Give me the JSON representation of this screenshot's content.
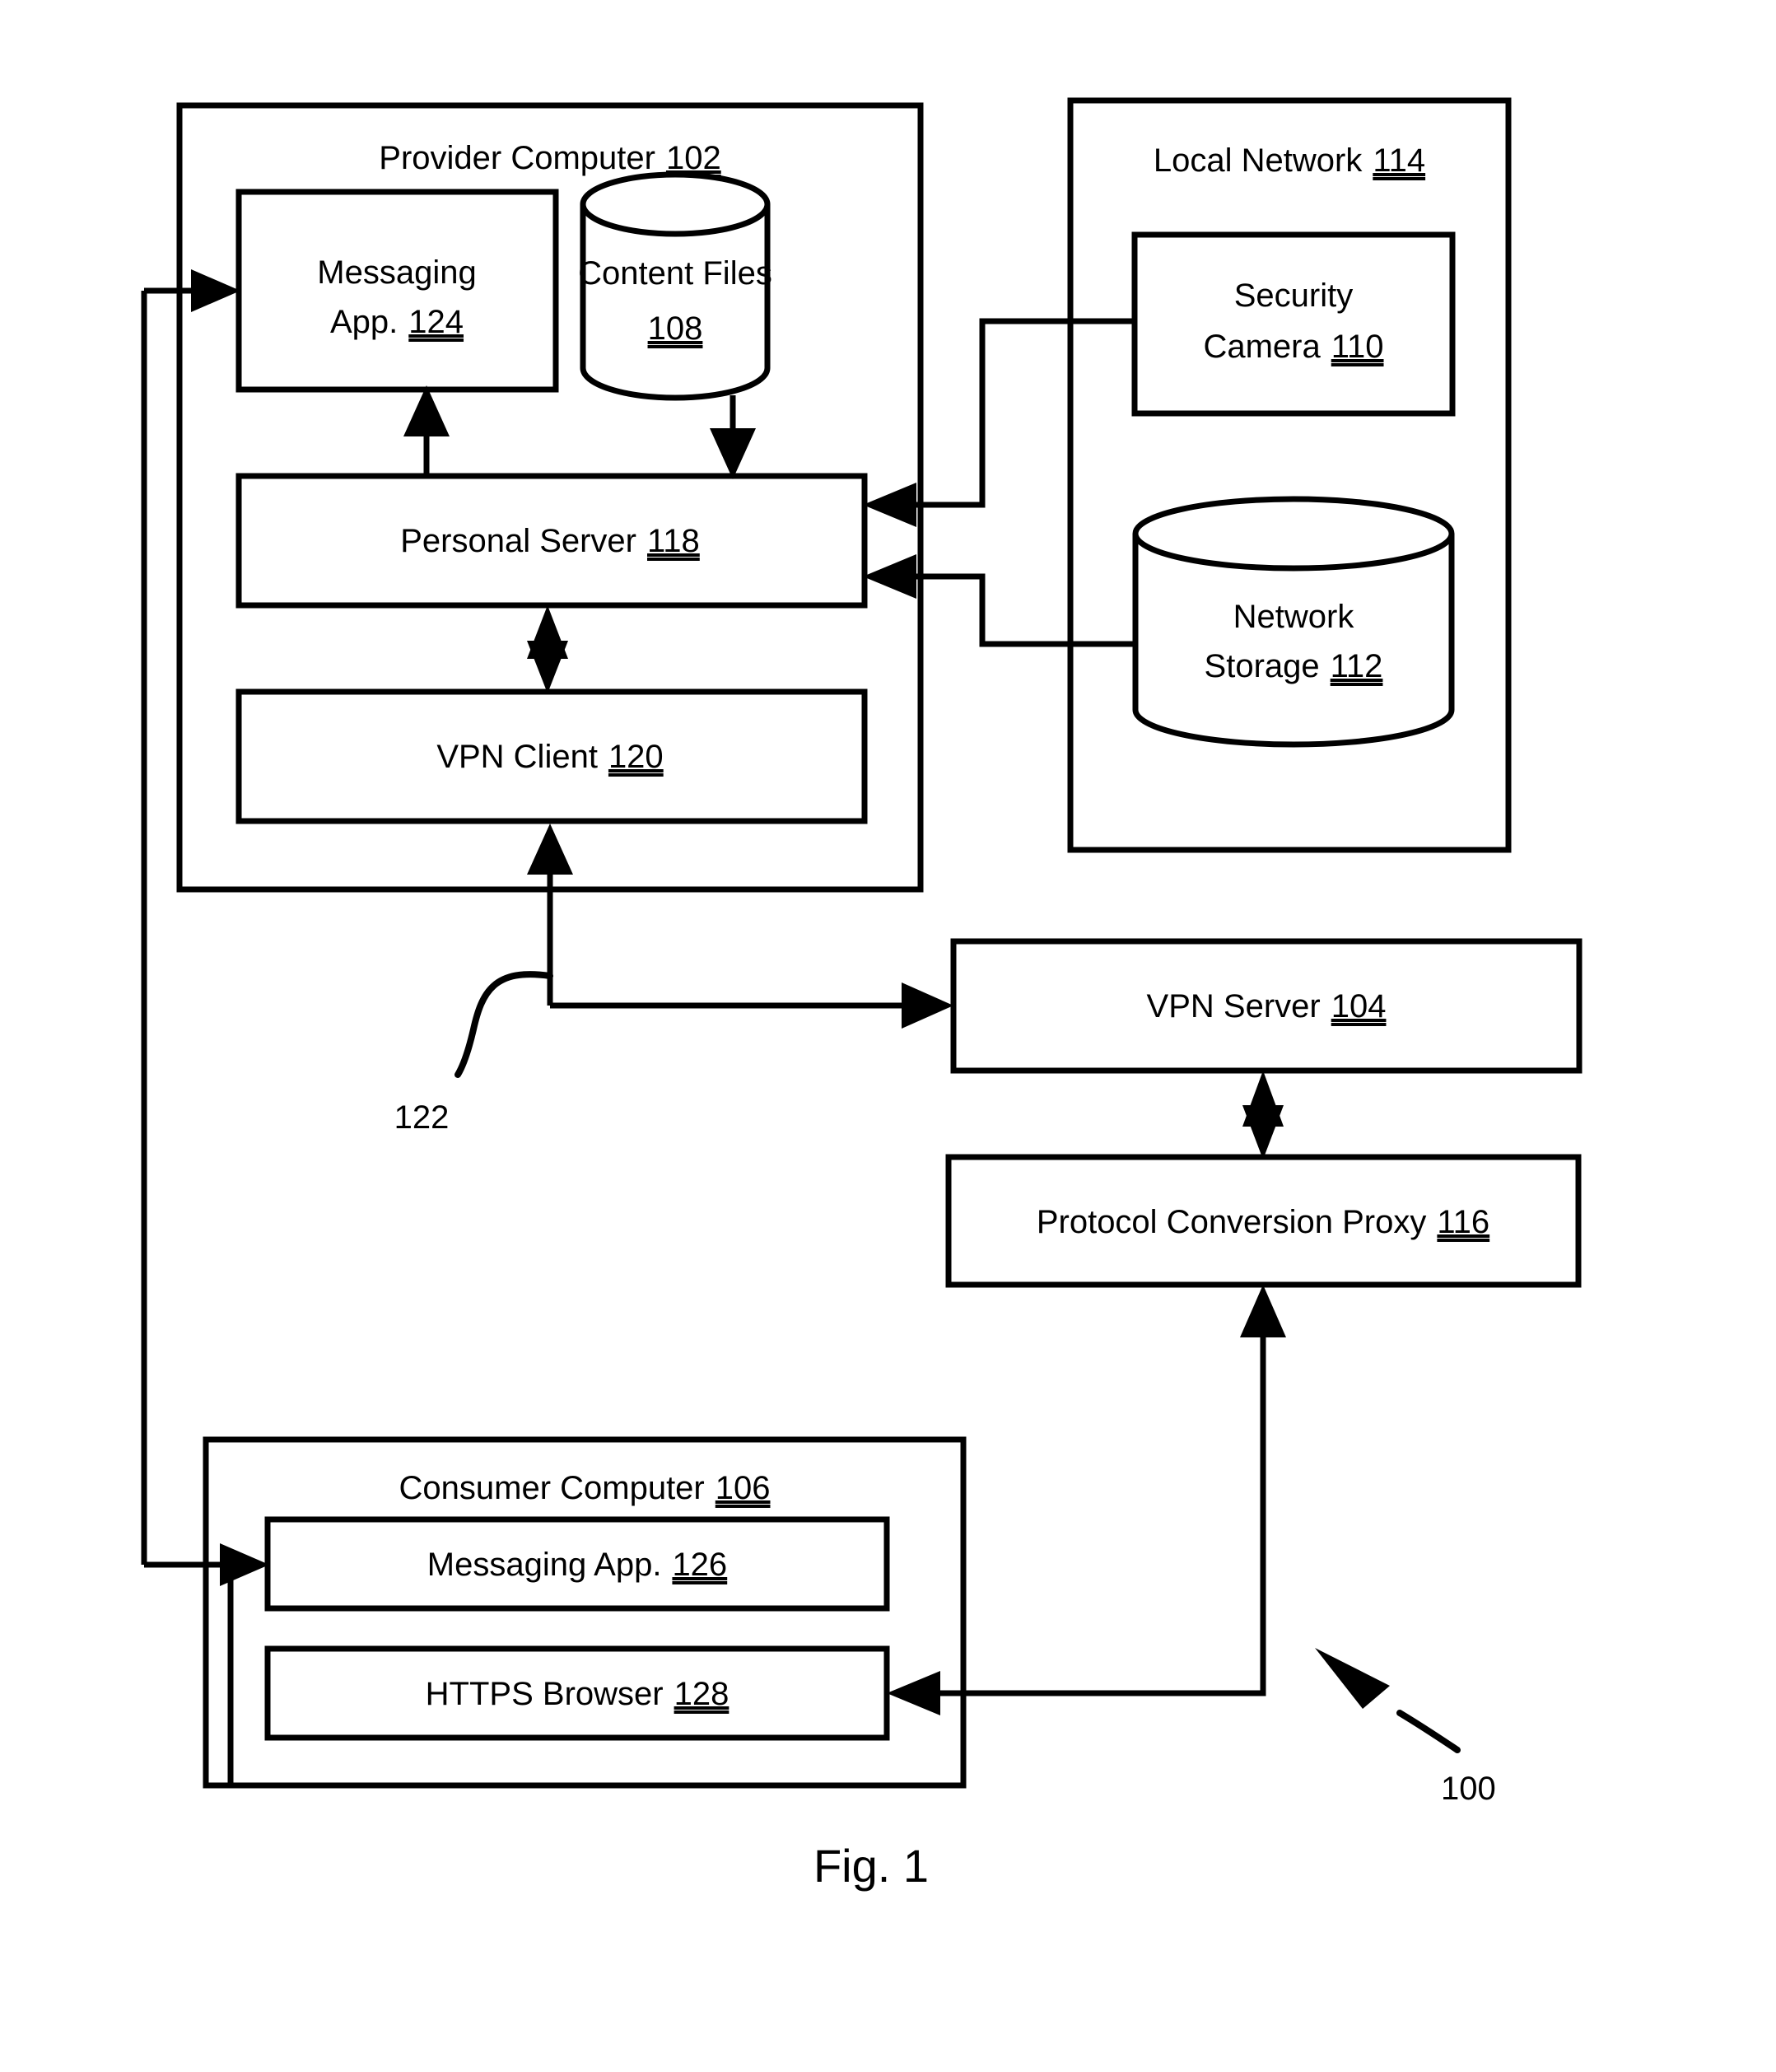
{
  "figure": {
    "caption": "Fig. 1",
    "system_reference": "100"
  },
  "containers": [
    {
      "id": "provider-computer",
      "title": "Provider Computer",
      "ref": "102"
    },
    {
      "id": "local-network",
      "title": "Local Network",
      "ref": "114"
    },
    {
      "id": "consumer-computer",
      "title": "Consumer Computer",
      "ref": "106"
    }
  ],
  "blocks": {
    "messaging_app_provider": {
      "label": "Messaging",
      "label2": "App.",
      "ref": "124",
      "shape": "rect"
    },
    "content_files": {
      "label": "Content Files",
      "label2": "",
      "ref": "108",
      "shape": "cylinder"
    },
    "personal_server": {
      "label": "Personal Server",
      "ref": "118",
      "shape": "rect"
    },
    "vpn_client": {
      "label": "VPN Client",
      "ref": "120",
      "shape": "rect"
    },
    "security_camera": {
      "label": "Security",
      "label2": "Camera",
      "ref": "110",
      "shape": "rect"
    },
    "network_storage": {
      "label": "Network",
      "label2": "Storage",
      "ref": "112",
      "shape": "cylinder"
    },
    "vpn_server": {
      "label": "VPN Server",
      "ref": "104",
      "shape": "rect"
    },
    "protocol_proxy": {
      "label": "Protocol Conversion Proxy",
      "ref": "116",
      "shape": "rect"
    },
    "messaging_app_consumer": {
      "label": "Messaging App.",
      "ref": "126",
      "shape": "rect"
    },
    "https_browser": {
      "label": "HTTPS Browser",
      "ref": "128",
      "shape": "rect"
    }
  },
  "leaders": {
    "vpn_tunnel": "122",
    "system": "100"
  },
  "colors": {
    "stroke": "#000000",
    "fill": "#ffffff",
    "background": "#ffffff"
  }
}
